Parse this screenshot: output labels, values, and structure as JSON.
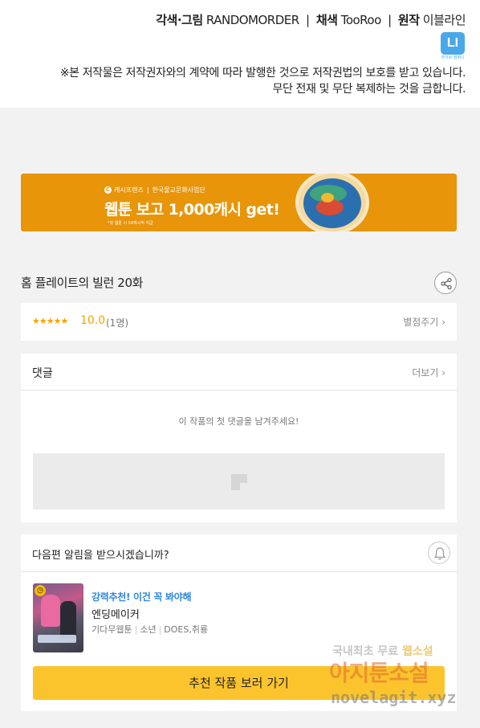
{
  "credits": {
    "art_label": "각색·그림",
    "art_value": "RANDOMORDER",
    "color_label": "채색",
    "color_value": "TooRoo",
    "original_label": "원작",
    "original_value": "이블라인",
    "separator": "|",
    "logo_text": "LI",
    "logo_sub": "라이브 컴퍼니",
    "notice_line1": "※본 저작물은 저작권자와의 계약에 따라 발행한 것으로 저작권법의 보호를 받고 있습니다.",
    "notice_line2": "무단 전재 및 무단 복제하는 것을 금합니다."
  },
  "banner": {
    "brand": "캐시프렌즈",
    "partner": "한국물교문화사업단",
    "headline": "웹툰 보고 1,000캐시 get!",
    "fine_print": "*첫 웹툰 시 50캐시씩 지급",
    "bg_color": "#e8950a"
  },
  "episode": {
    "title": "홈 플레이트의 빌런 20화",
    "share_icon": "share-icon"
  },
  "rating": {
    "stars": "★★★★★",
    "score": "10.0",
    "count": "(1명)",
    "rate_link": "별점주기"
  },
  "comments": {
    "title": "댓글",
    "more_link": "더보기",
    "empty_message": "이 작품의 첫 댓글을 남겨주세요!"
  },
  "next_episode": {
    "notify_text": "다음편 알림을 받으시겠습니까?",
    "bell_icon": "bell-icon",
    "recommend_label": "강력추천! 이건 꼭 봐야해",
    "recommend_title": "엔딩메이커",
    "meta_genre": "기다무웹툰",
    "meta_category": "소년",
    "meta_author": "DOES,취룡",
    "button_label": "추천 작품 보러 가기",
    "accent_color": "#fbc42d",
    "link_color": "#2f86dd"
  },
  "watermark": {
    "line1_a": "국내최초 무료",
    "line1_b": "웹소설",
    "line2": "아지툰소설",
    "line3": "novelagit.xyz"
  }
}
